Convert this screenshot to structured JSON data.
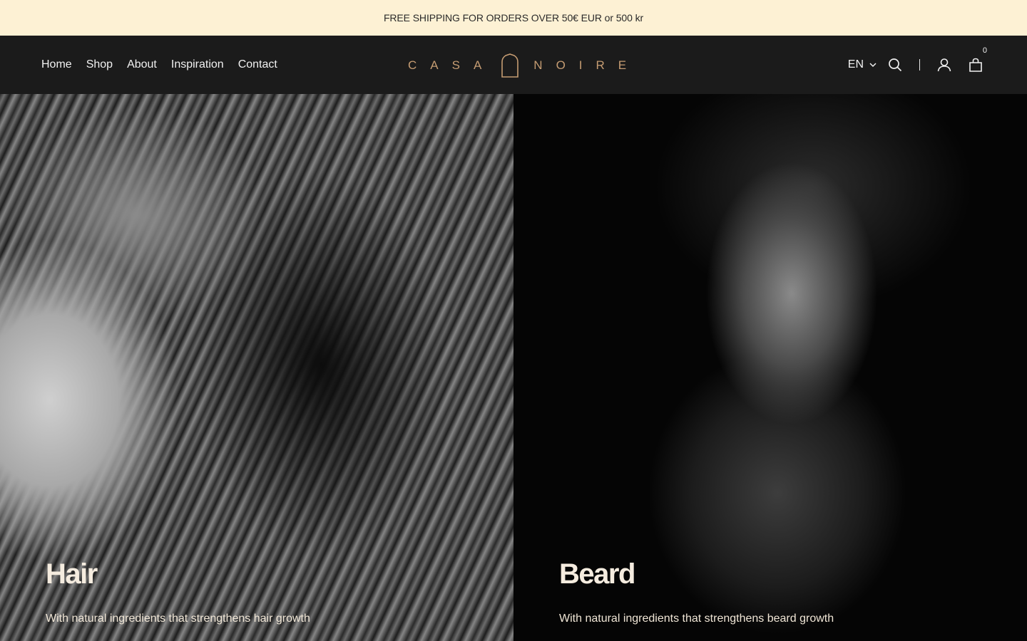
{
  "announcement": "FREE SHIPPING FOR ORDERS OVER 50€ EUR or 500 kr",
  "nav": {
    "items": [
      {
        "label": "Home"
      },
      {
        "label": "Shop"
      },
      {
        "label": "About"
      },
      {
        "label": "Inspiration"
      },
      {
        "label": "Contact"
      }
    ]
  },
  "logo": {
    "left": "CASA",
    "right": "NOIRE",
    "icon": "house-arch-icon",
    "color": "#c59c72"
  },
  "tools": {
    "language": "EN",
    "cart_count": "0",
    "icons": [
      "chevron-down-icon",
      "search-icon",
      "account-icon",
      "shopping-bag-icon"
    ]
  },
  "panels": [
    {
      "title": "Hair",
      "subtitle": "With natural ingredients that strengthens hair growth"
    },
    {
      "title": "Beard",
      "subtitle": "With natural ingredients that strengthens beard growth"
    }
  ],
  "colors": {
    "announcement_bg": "#fdf1d4",
    "header_bg": "#1b1b1b",
    "accent": "#c59c72"
  }
}
